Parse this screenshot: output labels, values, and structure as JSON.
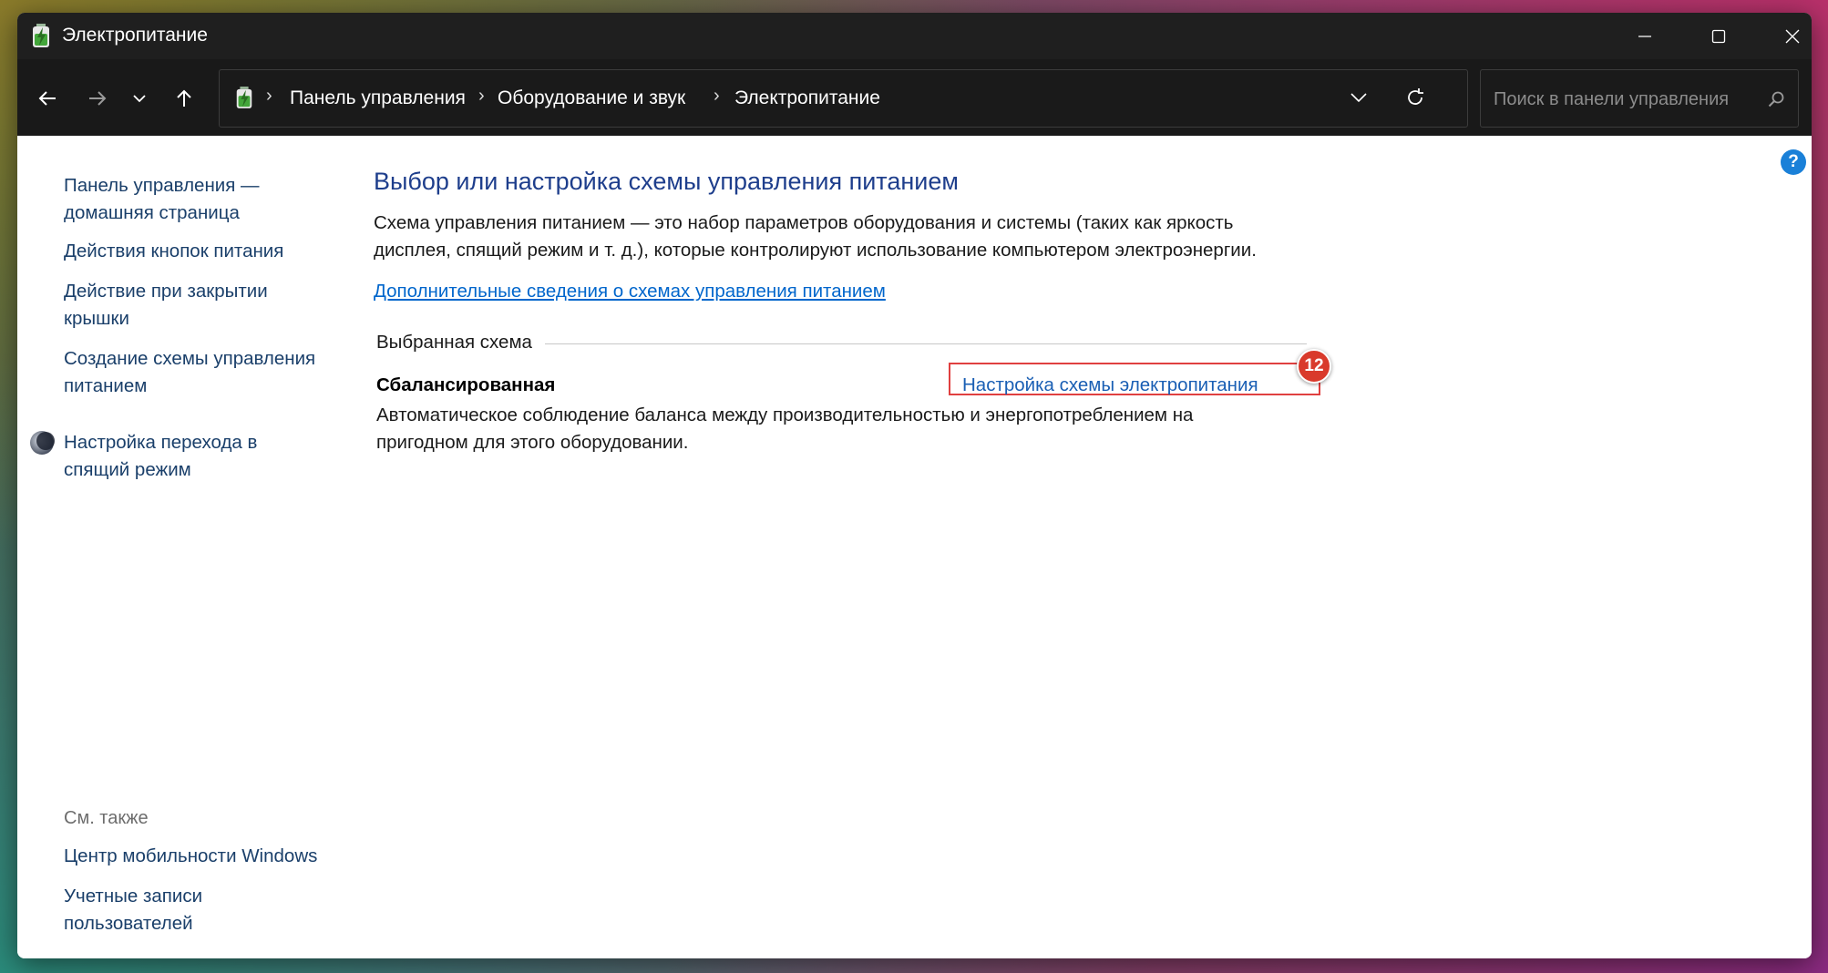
{
  "window": {
    "title": "Электропитание"
  },
  "navigation": {
    "breadcrumbs": [
      "Панель управления",
      "Оборудование и звук",
      "Электропитание"
    ],
    "separator": "›",
    "search_placeholder": "Поиск в панели управления"
  },
  "sidebar": {
    "links": [
      "Панель управления —\nдомашняя страница",
      "Действия кнопок питания",
      "Действие при закрытии\nкрышки",
      "Создание схемы управления\nпитанием",
      "Настройка перехода в\nспящий режим"
    ],
    "see_also_heading": "См. также",
    "see_also": [
      "Центр мобильности Windows",
      "Учетные записи\nпользователей"
    ]
  },
  "main": {
    "title": "Выбор или настройка схемы управления питанием",
    "description": "Схема управления питанием — это набор параметров оборудования и системы (таких как яркость дисплея, спящий режим и т. д.), которые контролируют использование компьютером электроэнергии.",
    "more_info_link": "Дополнительные сведения о схемах управления питанием",
    "selected_plan_label": "Выбранная схема",
    "plan": {
      "name": "Сбалансированная",
      "description": "Автоматическое соблюдение баланса между производительностью и энергопотреблением на пригодном для этого оборудовании.",
      "settings_link": "Настройка схемы электропитания"
    },
    "step_badge": "12",
    "help": "?"
  },
  "colors": {
    "title_bar": "#1f1f1f",
    "link": "#1a5fb4",
    "heading": "#1e3e8c",
    "highlight": "#e04040",
    "badge": "#d93a2b"
  }
}
